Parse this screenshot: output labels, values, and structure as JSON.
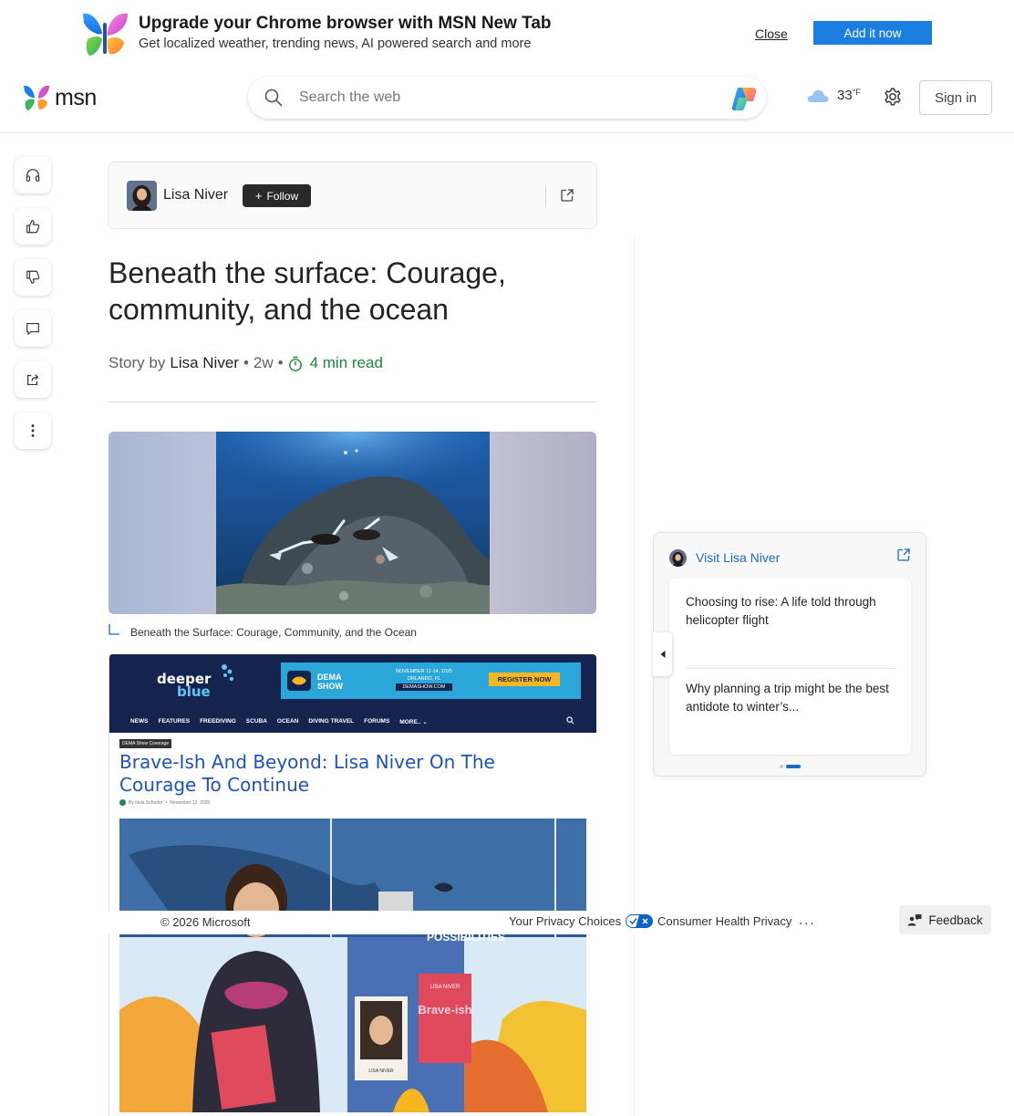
{
  "promo": {
    "title": "Upgrade your Chrome browser with MSN New Tab",
    "subtitle": "Get localized weather, trending news, AI powered search and more",
    "close_label": "Close",
    "add_label": "Add it now"
  },
  "header": {
    "logo_text": "msn",
    "search_placeholder": "Search the web",
    "weather_temp": "33",
    "weather_unit": "°F",
    "signin_label": "Sign in"
  },
  "rail": {
    "icons": [
      "headphones-icon",
      "thumbs-up-icon",
      "thumbs-down-icon",
      "comment-icon",
      "share-icon",
      "more-icon"
    ]
  },
  "author_card": {
    "name": "Lisa Niver",
    "follow_label": "Follow"
  },
  "article": {
    "headline": "Beneath the surface: Courage, community, and the ocean",
    "byline_prefix": "Story by",
    "byline_author": "Lisa Niver",
    "age": "2w",
    "read_time": "4 min read",
    "hero_caption": "Beneath the Surface: Courage, Community, and the Ocean"
  },
  "embedded_screenshot": {
    "site_logo_top": "deeper",
    "site_logo_bottom": "blue",
    "ad_brand": "DEMA SHOW",
    "ad_dates": "NOVEMBER 11-14, 2025",
    "ad_location": "ORLANDO, FL",
    "ad_site": "DEMASHOW.COM",
    "ad_cta": "REGISTER NOW",
    "nav": [
      "NEWS",
      "FEATURES",
      "FREEDIVING",
      "SCUBA",
      "OCEAN",
      "DIVING TRAVEL",
      "FORUMS",
      "MORE.. ⌄"
    ],
    "tag": "DEMA Show Coverage",
    "headline": "Brave-Ish And Beyond: Lisa Niver On The Courage To Continue",
    "byline": "By Nola Schoder",
    "date": "November 12, 2025",
    "photo_banner_text": "POSSIBILITIES",
    "book_author": "LISA NIVER",
    "book_title": "Brave-ish"
  },
  "footer": {
    "copyright": "© 2026 Microsoft",
    "privacy": "Your Privacy Choices",
    "health": "Consumer Health Privacy",
    "more": "...",
    "feedback": "Feedback"
  },
  "widget": {
    "title": "Visit Lisa Niver",
    "items": [
      "Choosing to rise: A life told through helicopter flight",
      "Why planning a trip might be the best antidote to winter’s..."
    ]
  },
  "colors": {
    "accent_blue": "#1b6ac9",
    "add_button": "#1a7fe0",
    "read_time_green": "#1a8b3a",
    "follow_button": "#292929"
  }
}
